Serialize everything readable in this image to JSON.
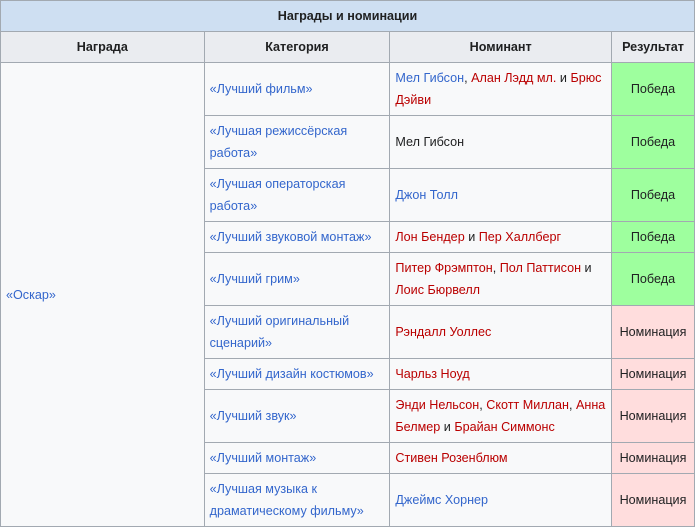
{
  "table": {
    "caption": "Награды и номинации",
    "headers": [
      "Награда",
      "Категория",
      "Номинант",
      "Результат"
    ],
    "award": "«Оскар»",
    "rows": [
      {
        "cat": "«Лучший фильм»",
        "result": "Победа",
        "nominees": [
          {
            "text": "Мел Гибсон",
            "style": "blue"
          },
          {
            "text": ", ",
            "style": "plain"
          },
          {
            "text": "Алан Лэдд мл.",
            "style": "red"
          },
          {
            "text": " и ",
            "style": "plain"
          },
          {
            "text": "Брюс Дэйви",
            "style": "red"
          }
        ]
      },
      {
        "cat": "«Лучшая режиссёрская работа»",
        "result": "Победа",
        "nominees": [
          {
            "text": "Мел Гибсон",
            "style": "plain"
          }
        ]
      },
      {
        "cat": "«Лучшая операторская работа»",
        "result": "Победа",
        "nominees": [
          {
            "text": "Джон Толл",
            "style": "blue"
          }
        ]
      },
      {
        "cat": "«Лучший звуковой монтаж»",
        "result": "Победа",
        "nominees": [
          {
            "text": "Лон Бендер",
            "style": "red"
          },
          {
            "text": " и ",
            "style": "plain"
          },
          {
            "text": "Пер Халлберг",
            "style": "red"
          }
        ]
      },
      {
        "cat": "«Лучший грим»",
        "result": "Победа",
        "nominees": [
          {
            "text": "Питер Фрэмптон",
            "style": "red"
          },
          {
            "text": ", ",
            "style": "plain"
          },
          {
            "text": "Пол Паттисон",
            "style": "red"
          },
          {
            "text": " и ",
            "style": "plain"
          },
          {
            "text": "Лоис Бюрвелл",
            "style": "red"
          }
        ]
      },
      {
        "cat": "«Лучший оригинальный сценарий»",
        "result": "Номинация",
        "nominees": [
          {
            "text": "Рэндалл Уоллес",
            "style": "red"
          }
        ]
      },
      {
        "cat": "«Лучший дизайн костюмов»",
        "result": "Номинация",
        "nominees": [
          {
            "text": "Чарльз Ноуд",
            "style": "red"
          }
        ]
      },
      {
        "cat": "«Лучший звук»",
        "result": "Номинация",
        "nominees": [
          {
            "text": "Энди Нельсон",
            "style": "red"
          },
          {
            "text": ", ",
            "style": "plain"
          },
          {
            "text": "Скотт Миллан",
            "style": "red"
          },
          {
            "text": ", ",
            "style": "plain"
          },
          {
            "text": "Анна Белмер",
            "style": "red"
          },
          {
            "text": " и ",
            "style": "plain"
          },
          {
            "text": "Брайан Симмонс",
            "style": "red"
          }
        ]
      },
      {
        "cat": "«Лучший монтаж»",
        "result": "Номинация",
        "nominees": [
          {
            "text": "Стивен Розенблюм",
            "style": "red"
          }
        ]
      },
      {
        "cat": "«Лучшая музыка к драматическому фильму»",
        "result": "Номинация",
        "nominees": [
          {
            "text": "Джеймс Хорнер",
            "style": "blue"
          }
        ]
      }
    ]
  }
}
